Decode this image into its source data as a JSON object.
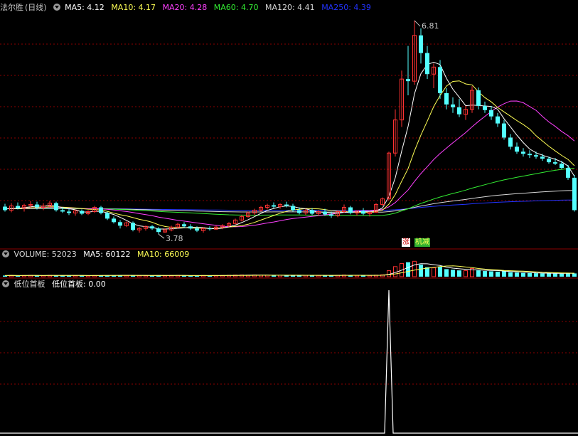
{
  "main_panel": {
    "stock_name": "法尔胜",
    "period": "(日线)",
    "ma": [
      {
        "label": "MA5: 4.12",
        "color": "#ffffff"
      },
      {
        "label": "MA10: 4.17",
        "color": "#ffff55"
      },
      {
        "label": "MA20: 4.28",
        "color": "#ff40ff"
      },
      {
        "label": "MA60: 4.70",
        "color": "#33ee33"
      },
      {
        "label": "MA120: 4.41",
        "color": "#d8d8d8"
      },
      {
        "label": "MA250: 4.39",
        "color": "#2233ff"
      }
    ],
    "high_annotation": "6.81",
    "low_annotation": "3.78",
    "badge_zhang": "涨",
    "badge_jian": "机减"
  },
  "volume_panel": {
    "title": "VOLUME: 52023",
    "ma5": "MA5: 60122",
    "ma10": "MA10: 66009"
  },
  "indicator_panel": {
    "name": "低位首板",
    "value": "低位首板: 0.00"
  },
  "colors": {
    "up": "#ff3232",
    "down": "#54ffff",
    "grid": "#8b0000",
    "divider": "#8b0000",
    "ma5": "#ffffff",
    "ma10": "#ffff55",
    "ma20": "#ff40ff",
    "ma60": "#33ee33",
    "ma120": "#d8d8d8",
    "ma250": "#2233ff"
  },
  "chart_data": [
    {
      "type": "candlestick",
      "title": "法尔胜 (日线)",
      "ylim": [
        3.6,
        6.9
      ],
      "marked_high": 6.81,
      "marked_low": 3.78,
      "series": [
        {
          "name": "MA5",
          "last": 4.12
        },
        {
          "name": "MA10",
          "last": 4.17
        },
        {
          "name": "MA20",
          "last": 4.28
        },
        {
          "name": "MA60",
          "last": 4.7
        },
        {
          "name": "MA120",
          "last": 4.41
        },
        {
          "name": "MA250",
          "last": 4.39
        }
      ],
      "ohlc": [
        [
          4.17,
          4.21,
          4.1,
          4.12
        ],
        [
          4.12,
          4.22,
          4.09,
          4.18
        ],
        [
          4.18,
          4.23,
          4.13,
          4.15
        ],
        [
          4.15,
          4.21,
          4.1,
          4.19
        ],
        [
          4.19,
          4.25,
          4.15,
          4.2
        ],
        [
          4.2,
          4.24,
          4.13,
          4.16
        ],
        [
          4.16,
          4.22,
          4.12,
          4.18
        ],
        [
          4.18,
          4.25,
          4.16,
          4.22
        ],
        [
          4.22,
          4.24,
          4.1,
          4.12
        ],
        [
          4.12,
          4.16,
          4.08,
          4.1
        ],
        [
          4.1,
          4.14,
          4.05,
          4.08
        ],
        [
          4.08,
          4.13,
          4.04,
          4.11
        ],
        [
          4.11,
          4.13,
          4.05,
          4.07
        ],
        [
          4.07,
          4.12,
          4.05,
          4.1
        ],
        [
          4.1,
          4.18,
          4.08,
          4.16
        ],
        [
          4.16,
          4.18,
          4.06,
          4.08
        ],
        [
          4.08,
          4.1,
          3.98,
          4.0
        ],
        [
          4.0,
          4.03,
          3.93,
          3.95
        ],
        [
          3.95,
          3.98,
          3.86,
          3.9
        ],
        [
          3.9,
          3.96,
          3.88,
          3.94
        ],
        [
          3.94,
          3.96,
          3.82,
          3.84
        ],
        [
          3.84,
          3.88,
          3.8,
          3.86
        ],
        [
          3.86,
          3.9,
          3.83,
          3.89
        ],
        [
          3.89,
          3.91,
          3.84,
          3.86
        ],
        [
          3.86,
          3.88,
          3.78,
          3.81
        ],
        [
          3.81,
          3.86,
          3.8,
          3.84
        ],
        [
          3.84,
          3.9,
          3.82,
          3.88
        ],
        [
          3.88,
          3.94,
          3.86,
          3.92
        ],
        [
          3.92,
          3.95,
          3.87,
          3.89
        ],
        [
          3.89,
          3.92,
          3.84,
          3.86
        ],
        [
          3.86,
          3.89,
          3.81,
          3.83
        ],
        [
          3.83,
          3.88,
          3.8,
          3.86
        ],
        [
          3.86,
          3.89,
          3.83,
          3.85
        ],
        [
          3.85,
          3.9,
          3.84,
          3.88
        ],
        [
          3.88,
          3.92,
          3.85,
          3.9
        ],
        [
          3.9,
          3.95,
          3.88,
          3.93
        ],
        [
          3.93,
          4.0,
          3.92,
          3.98
        ],
        [
          3.98,
          4.05,
          3.96,
          4.03
        ],
        [
          4.03,
          4.1,
          4.01,
          4.08
        ],
        [
          4.08,
          4.14,
          4.05,
          4.12
        ],
        [
          4.12,
          4.18,
          4.1,
          4.16
        ],
        [
          4.16,
          4.21,
          4.13,
          4.19
        ],
        [
          4.19,
          4.23,
          4.15,
          4.17
        ],
        [
          4.17,
          4.22,
          4.14,
          4.2
        ],
        [
          4.2,
          4.24,
          4.16,
          4.18
        ],
        [
          4.18,
          4.21,
          4.1,
          4.12
        ],
        [
          4.12,
          4.16,
          4.06,
          4.08
        ],
        [
          4.08,
          4.14,
          4.05,
          4.12
        ],
        [
          4.12,
          4.15,
          4.05,
          4.07
        ],
        [
          4.07,
          4.12,
          4.04,
          4.1
        ],
        [
          4.1,
          4.14,
          4.04,
          4.06
        ],
        [
          4.06,
          4.1,
          4.01,
          4.04
        ],
        [
          4.04,
          4.12,
          4.02,
          4.1
        ],
        [
          4.1,
          4.2,
          4.08,
          4.16
        ],
        [
          4.16,
          4.18,
          4.06,
          4.08
        ],
        [
          4.08,
          4.12,
          4.04,
          4.11
        ],
        [
          4.11,
          4.15,
          4.05,
          4.07
        ],
        [
          4.07,
          4.1,
          4.03,
          4.09
        ],
        [
          4.09,
          4.22,
          4.08,
          4.2
        ],
        [
          4.2,
          4.3,
          4.18,
          4.28
        ],
        [
          4.28,
          4.95,
          4.26,
          4.93
        ],
        [
          4.93,
          5.55,
          4.88,
          5.4
        ],
        [
          5.4,
          6.1,
          5.3,
          5.98
        ],
        [
          5.98,
          6.45,
          5.75,
          5.95
        ],
        [
          5.95,
          6.81,
          5.9,
          6.6
        ],
        [
          6.6,
          6.7,
          6.2,
          6.35
        ],
        [
          6.35,
          6.45,
          5.98,
          6.05
        ],
        [
          6.05,
          6.2,
          5.85,
          6.15
        ],
        [
          6.15,
          6.25,
          5.7,
          5.78
        ],
        [
          5.78,
          5.85,
          5.55,
          5.62
        ],
        [
          5.62,
          5.72,
          5.5,
          5.58
        ],
        [
          5.58,
          5.7,
          5.44,
          5.48
        ],
        [
          5.48,
          5.6,
          5.4,
          5.55
        ],
        [
          5.55,
          5.88,
          5.5,
          5.82
        ],
        [
          5.82,
          5.86,
          5.55,
          5.6
        ],
        [
          5.6,
          5.66,
          5.5,
          5.54
        ],
        [
          5.54,
          5.6,
          5.4,
          5.45
        ],
        [
          5.45,
          5.5,
          5.3,
          5.35
        ],
        [
          5.35,
          5.4,
          5.12,
          5.15
        ],
        [
          5.15,
          5.2,
          4.98,
          5.02
        ],
        [
          5.02,
          5.08,
          4.92,
          4.95
        ],
        [
          4.95,
          5.0,
          4.88,
          4.92
        ],
        [
          4.92,
          4.97,
          4.86,
          4.9
        ],
        [
          4.9,
          4.95,
          4.85,
          4.88
        ],
        [
          4.88,
          4.92,
          4.82,
          4.85
        ],
        [
          4.85,
          4.88,
          4.78,
          4.8
        ],
        [
          4.8,
          4.86,
          4.76,
          4.78
        ],
        [
          4.78,
          4.82,
          4.7,
          4.72
        ],
        [
          4.72,
          4.76,
          4.55,
          4.58
        ],
        [
          4.58,
          4.62,
          4.1,
          4.12
        ]
      ]
    },
    {
      "type": "bar",
      "title": "VOLUME: 52023",
      "series": [
        {
          "name": "MA5",
          "last": 60122
        },
        {
          "name": "MA10",
          "last": 66009
        }
      ],
      "values": [
        18000,
        20000,
        17000,
        19000,
        21000,
        18000,
        17000,
        20000,
        22000,
        19000,
        18000,
        17000,
        18000,
        16000,
        19000,
        21000,
        20000,
        23000,
        22000,
        19000,
        21000,
        18000,
        17000,
        18000,
        20000,
        17000,
        19000,
        21000,
        18000,
        17000,
        18000,
        19000,
        17000,
        18000,
        20000,
        22000,
        25000,
        27000,
        24000,
        26000,
        23000,
        22000,
        21000,
        23000,
        20000,
        22000,
        24000,
        21000,
        20000,
        19000,
        21000,
        20000,
        23000,
        26000,
        22000,
        20000,
        21000,
        19000,
        24000,
        30000,
        95000,
        160000,
        210000,
        230000,
        245000,
        190000,
        150000,
        140000,
        160000,
        120000,
        110000,
        100000,
        95000,
        130000,
        100000,
        90000,
        85000,
        80000,
        90000,
        70000,
        65000,
        60000,
        58000,
        55000,
        52000,
        54000,
        50000,
        48000,
        60000,
        52023
      ]
    },
    {
      "type": "line",
      "title": "低位首板",
      "last": 0.0,
      "signal_index": 60,
      "signal_value": 1
    }
  ]
}
